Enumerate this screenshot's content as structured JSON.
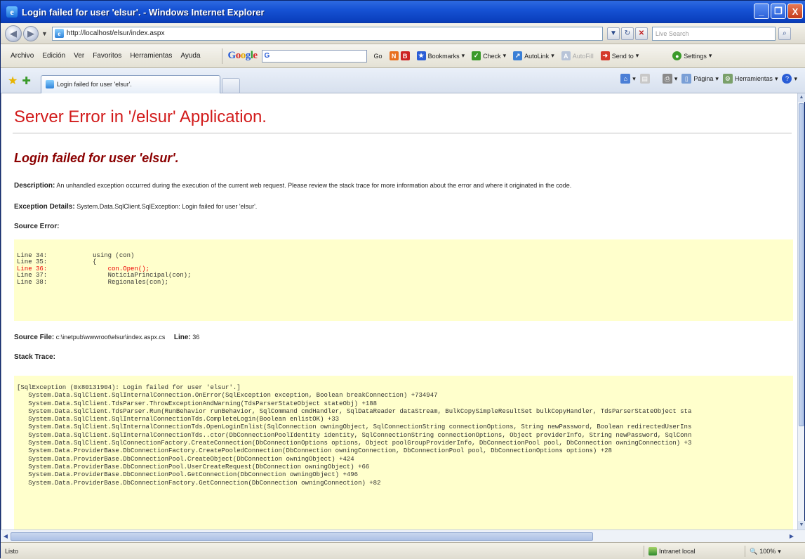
{
  "window": {
    "title": "Login failed for user 'elsur'. - Windows Internet Explorer",
    "minimize": "_",
    "maximize": "❐",
    "close": "X"
  },
  "address_bar": {
    "url": "http://localhost/elsur/index.aspx",
    "search_placeholder": "Live Search"
  },
  "menu": {
    "items": [
      "Archivo",
      "Edición",
      "Ver",
      "Favoritos",
      "Herramientas",
      "Ayuda"
    ]
  },
  "google_toolbar": {
    "search_value": "G",
    "go_label": "Go",
    "bookmarks": "Bookmarks",
    "check": "Check",
    "autolink": "AutoLink",
    "autofill": "AutoFill",
    "sendto": "Send to",
    "settings": "Settings"
  },
  "tabs": [
    {
      "label": "Login failed for user 'elsur'."
    }
  ],
  "command_bar": {
    "page": "Página",
    "tools": "Herramientas"
  },
  "page": {
    "heading": "Server Error in '/elsur' Application.",
    "error_message": "Login failed for user 'elsur'.",
    "description_label": "Description:",
    "description": "An unhandled exception occurred during the execution of the current web request. Please review the stack trace for more information about the error and where it originated in the code.",
    "exception_label": "Exception Details:",
    "exception": "System.Data.SqlClient.SqlException: Login failed for user 'elsur'.",
    "source_error_label": "Source Error:",
    "source_lines": [
      {
        "num": "Line 34:",
        "code": "            using (con)",
        "highlight": false
      },
      {
        "num": "Line 35:",
        "code": "            {",
        "highlight": false
      },
      {
        "num": "Line 36:",
        "code": "                con.Open();",
        "highlight": true
      },
      {
        "num": "Line 37:",
        "code": "                NoticiaPrincipal(con);",
        "highlight": false
      },
      {
        "num": "Line 38:",
        "code": "                Regionales(con);",
        "highlight": false
      }
    ],
    "source_file_label": "Source File:",
    "source_file": "c:\\inetpub\\wwwroot\\elsur\\index.aspx.cs",
    "line_label": "Line:",
    "line_number": "36",
    "stack_trace_label": "Stack Trace:",
    "stack_trace": [
      "[SqlException (0x80131904): Login failed for user 'elsur'.]",
      "   System.Data.SqlClient.SqlInternalConnection.OnError(SqlException exception, Boolean breakConnection) +734947",
      "   System.Data.SqlClient.TdsParser.ThrowExceptionAndWarning(TdsParserStateObject stateObj) +188",
      "   System.Data.SqlClient.TdsParser.Run(RunBehavior runBehavior, SqlCommand cmdHandler, SqlDataReader dataStream, BulkCopySimpleResultSet bulkCopyHandler, TdsParserStateObject sta",
      "   System.Data.SqlClient.SqlInternalConnectionTds.CompleteLogin(Boolean enlistOK) +33",
      "   System.Data.SqlClient.SqlInternalConnectionTds.OpenLoginEnlist(SqlConnection owningObject, SqlConnectionString connectionOptions, String newPassword, Boolean redirectedUserIns",
      "   System.Data.SqlClient.SqlInternalConnectionTds..ctor(DbConnectionPoolIdentity identity, SqlConnectionString connectionOptions, Object providerInfo, String newPassword, SqlConn",
      "   System.Data.SqlClient.SqlConnectionFactory.CreateConnection(DbConnectionOptions options, Object poolGroupProviderInfo, DbConnectionPool pool, DbConnection owningConnection) +3",
      "   System.Data.ProviderBase.DbConnectionFactory.CreatePooledConnection(DbConnection owningConnection, DbConnectionPool pool, DbConnectionOptions options) +28",
      "   System.Data.ProviderBase.DbConnectionPool.CreateObject(DbConnection owningObject) +424",
      "   System.Data.ProviderBase.DbConnectionPool.UserCreateRequest(DbConnection owningObject) +66",
      "   System.Data.ProviderBase.DbConnectionPool.GetConnection(DbConnection owningObject) +496",
      "   System.Data.ProviderBase.DbConnectionFactory.GetConnection(DbConnection owningConnection) +82"
    ]
  },
  "status_bar": {
    "text": "Listo",
    "zone": "Intranet local",
    "zoom": "100%"
  },
  "colors": {
    "heading_red": "#d21b1b",
    "message_darkred": "#8b0000",
    "code_bg": "#ffffcc",
    "highlight_line": "#ee0000",
    "titlebar_blue": "#1652d4"
  }
}
